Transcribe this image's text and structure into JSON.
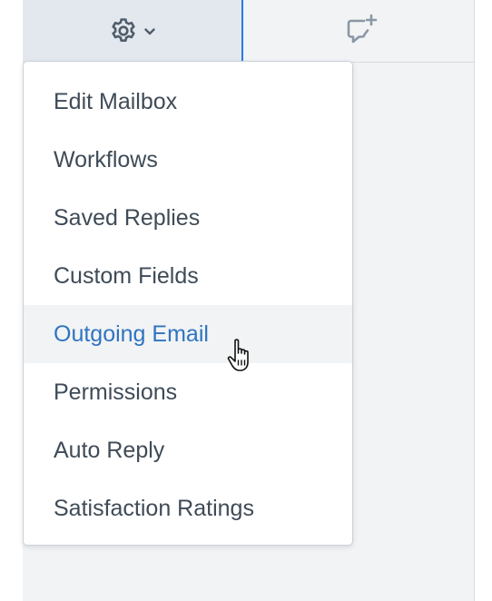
{
  "toolbar": {
    "settings_icon": "gear-icon",
    "dropdown_icon": "chevron-down-icon",
    "new_conversation_icon": "chat-plus-icon",
    "accent_color": "#2c7be5"
  },
  "menu": {
    "items": [
      {
        "label": "Edit Mailbox"
      },
      {
        "label": "Workflows"
      },
      {
        "label": "Saved Replies"
      },
      {
        "label": "Custom Fields"
      },
      {
        "label": "Outgoing Email"
      },
      {
        "label": "Permissions"
      },
      {
        "label": "Auto Reply"
      },
      {
        "label": "Satisfaction Ratings"
      }
    ],
    "active_item": "Outgoing Email",
    "active_color": "#2f74c0",
    "text_color": "#3f4b57"
  },
  "cursor": {
    "icon": "hand-pointer-icon"
  }
}
